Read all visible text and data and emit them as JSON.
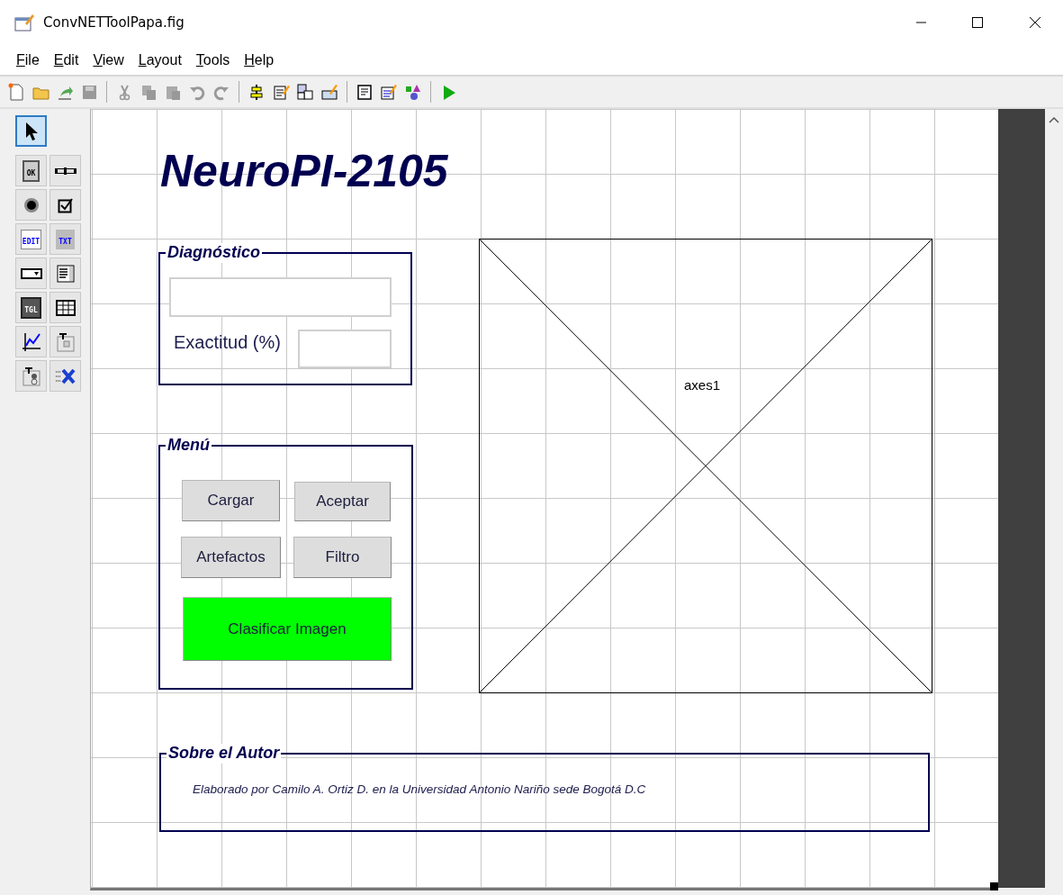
{
  "window": {
    "title": "ConvNETToolPapa.fig"
  },
  "menu": [
    "File",
    "Edit",
    "View",
    "Layout",
    "Tools",
    "Help"
  ],
  "palette": [
    {
      "kind": "pointer",
      "selected": true
    },
    {
      "kind": "push",
      "label": "OK",
      "selected": false
    },
    {
      "kind": "slider",
      "selected": false
    },
    {
      "kind": "radio",
      "selected": false
    },
    {
      "kind": "check",
      "selected": false
    },
    {
      "kind": "edit",
      "label": "EDIT",
      "selected": false
    },
    {
      "kind": "text",
      "label": "TXT",
      "selected": false
    },
    {
      "kind": "popup",
      "selected": false
    },
    {
      "kind": "listbox",
      "selected": false
    },
    {
      "kind": "toggle",
      "label": "TGL",
      "selected": false
    },
    {
      "kind": "table",
      "selected": false
    },
    {
      "kind": "axes",
      "selected": false
    },
    {
      "kind": "panel",
      "selected": false
    },
    {
      "kind": "group",
      "selected": false
    },
    {
      "kind": "activex",
      "selected": false
    }
  ],
  "canvas": {
    "title": "NeuroPI-2105",
    "panels": [
      {
        "title": "Diagnóstico"
      },
      {
        "title": "Menú"
      },
      {
        "title": "Sobre el Autor"
      }
    ],
    "accuracy": {
      "label": "Exactitud (%)"
    },
    "buttons": [
      {
        "label": "Cargar",
        "color": "#dddddd"
      },
      {
        "label": "Aceptar",
        "color": "#dddddd"
      },
      {
        "label": "Artefactos",
        "color": "#dddddd"
      },
      {
        "label": "Filtro",
        "color": "#dddddd"
      },
      {
        "label": "Clasificar Imagen",
        "color": "#00ff00"
      }
    ],
    "axes": {
      "label": "axes1"
    },
    "author_text": "Elaborado por Camilo A. Ortiz D. en la Universidad Antonio Nariño sede Bogotá D.C"
  }
}
